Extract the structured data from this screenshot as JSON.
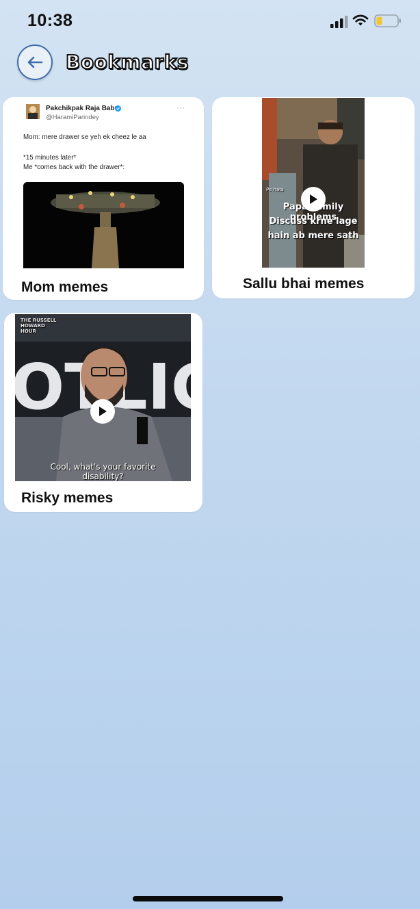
{
  "status": {
    "time": "10:38"
  },
  "header": {
    "title": "Bookmarks",
    "back_icon": "arrow-left-icon"
  },
  "bookmarks": [
    {
      "label": "Mom memes",
      "tweet": {
        "name": "Pakchikpak Raja Babu",
        "handle": "@HaramiParindey",
        "more": "···",
        "line1": "Mom: mere drawer se yeh ek cheez le aa",
        "line2": "*15 minutes later*",
        "line3": "Me *comes back with the drawer*:"
      }
    },
    {
      "label": "Sallu bhai memes",
      "video": {
        "watermark": "Pe hats",
        "caption_1": "Papa Family problems",
        "caption_2": "Discuss krne lage",
        "caption_3": "hain ab mere sath"
      }
    },
    {
      "label": "Risky memes",
      "video": {
        "channel": "THE RUSSELL HOWARD HOUR",
        "bg_text": "OTLIGH",
        "caption_1": "Cool, what's your favorite",
        "caption_2": "disability?"
      }
    }
  ],
  "colors": {
    "accent": "#3f6eaa",
    "card_bg": "#ffffff"
  }
}
